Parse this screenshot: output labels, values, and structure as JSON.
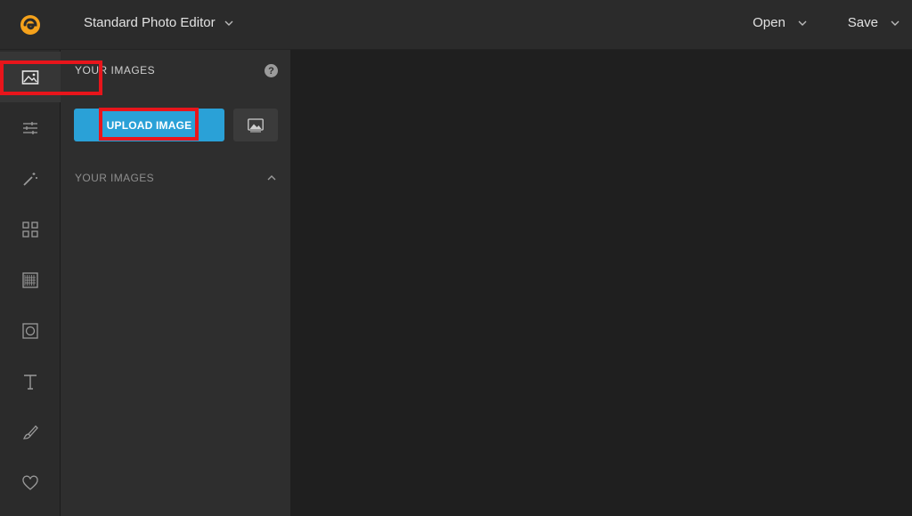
{
  "topbar": {
    "editor_mode": "Standard Photo Editor",
    "open_label": "Open",
    "save_label": "Save",
    "logo_color": "#f5a21b"
  },
  "rail": {
    "items": [
      {
        "name": "images",
        "icon": "image-icon",
        "active": true
      },
      {
        "name": "adjustments",
        "icon": "sliders-icon"
      },
      {
        "name": "effects",
        "icon": "magic-wand-icon"
      },
      {
        "name": "collage",
        "icon": "grid-icon"
      },
      {
        "name": "frames",
        "icon": "frame-icon"
      },
      {
        "name": "overlays",
        "icon": "vignette-icon"
      },
      {
        "name": "text",
        "icon": "text-icon"
      },
      {
        "name": "draw",
        "icon": "brush-icon"
      },
      {
        "name": "favorites",
        "icon": "heart-icon"
      }
    ]
  },
  "panel": {
    "header": "YOUR IMAGES",
    "upload_label": "UPLOAD IMAGE",
    "section_title": "YOUR IMAGES"
  },
  "colors": {
    "accent": "#2aa1d7",
    "highlight": "#e8151b"
  }
}
